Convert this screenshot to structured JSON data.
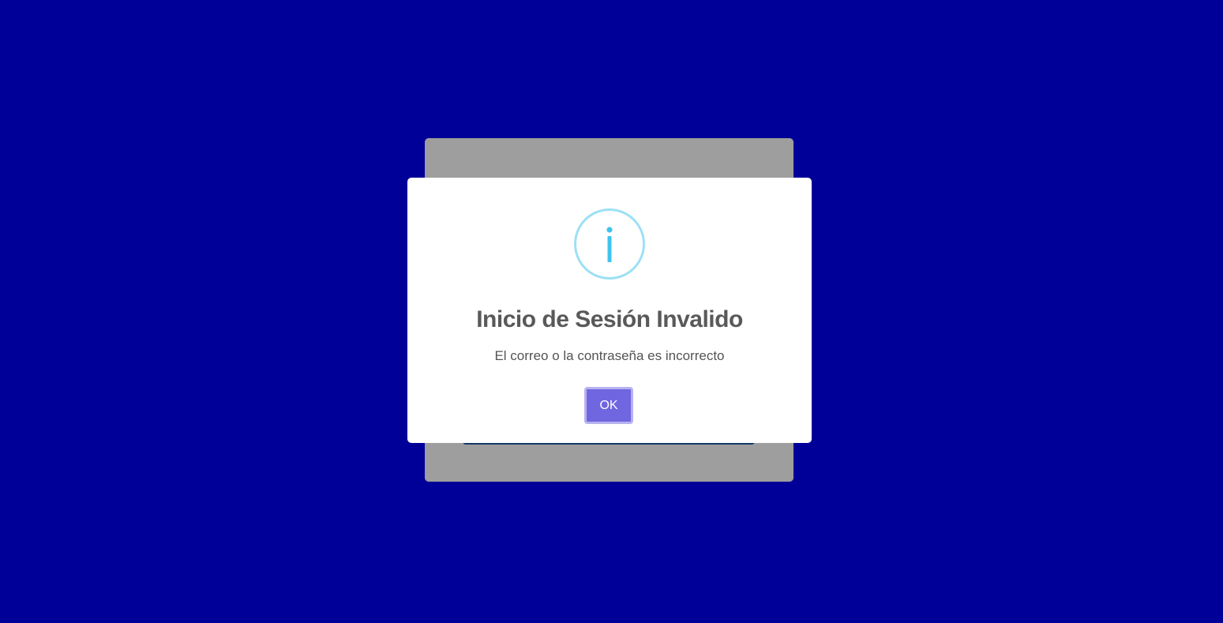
{
  "dialog": {
    "icon": "info-icon",
    "title": "Inicio de Sesión Invalido",
    "message": "El correo o la contraseña es incorrecto",
    "confirm_label": "OK"
  },
  "colors": {
    "background": "#000099",
    "overlay": "rgba(0,0,0,0.38)",
    "icon": "#3fc3ee",
    "icon_ring": "#9de0f6",
    "title_text": "#595959",
    "message_text": "#545454",
    "confirm_button": "#7066e0"
  }
}
